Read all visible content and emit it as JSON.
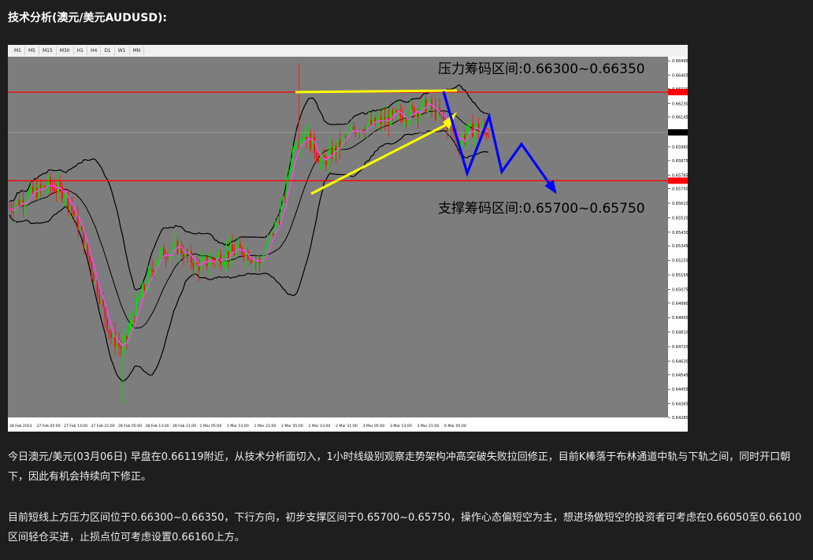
{
  "article": {
    "title": "技术分析(澳元/美元AUDUSD):",
    "paragraph1": "今日澳元/美元(03月06日) 早盘在0.66119附近，从技术分析面切入，1小时线级别观察走势架构冲高突破失败拉回修正，目前K棒落于布林通道中轨与下轨之间，同时开口朝下，因此有机会持续向下修正。",
    "paragraph2": "目前短线上方压力区间位于0.66300~0.66350，下行方向，初步支撑区间于0.65700~0.65750，操作心态偏短空为主，想进场做短空的投资者可考虑在0.66050至0.66100区间轻仓买进，止损点位可考虑设置0.66160上方。"
  },
  "toolbar": {
    "timeframes": [
      "M1",
      "M5",
      "M15",
      "M30",
      "H1",
      "H4",
      "D1",
      "W1",
      "MN"
    ]
  },
  "chart_data": {
    "type": "candlestick",
    "symbol": "AUDUSD",
    "timeframe": "H1",
    "annotations": {
      "resistance": "压力筹码区间:0.66300~0.66350",
      "support": "支撑筹码区间:0.65700~0.65750"
    },
    "resistance_level": 0.663,
    "support_level": 0.6575,
    "current_price": 0.6605,
    "ylim": [
      0.6428,
      0.6652
    ],
    "y_ticks": [
      "0.66495",
      "0.66405",
      "0.66320",
      "0.66230",
      "0.66145",
      "0.66050",
      "0.65960",
      "0.65875",
      "0.65785",
      "0.65700",
      "0.65610",
      "0.65520",
      "0.65430",
      "0.65345",
      "0.65255",
      "0.65165",
      "0.65075",
      "0.64990",
      "0.64900",
      "0.64810",
      "0.64720",
      "0.64630",
      "0.64545",
      "0.64455",
      "0.64365",
      "0.64280"
    ],
    "x_ticks": [
      "28 Feb 2023",
      "27 Feb 05:00",
      "27 Feb 13:00",
      "27 Feb 21:00",
      "28 Feb 05:00",
      "28 Feb 13:00",
      "28 Feb 21:00",
      "1 Mar 05:00",
      "1 Mar 13:00",
      "1 Mar 21:00",
      "2 Mar 05:00",
      "2 Mar 13:00",
      "2 Mar 21:00",
      "3 Mar 05:00",
      "3 Mar 13:00",
      "3 Mar 21:00",
      "6 Mar 05:00"
    ],
    "colors": {
      "background": "#7d7d7d",
      "bull_candle": "#00e000",
      "bear_candle": "#ff1010",
      "bands": "#000000",
      "middle_band": "#ff40ff",
      "level_line": "#ff0000",
      "yellow": "#ffff00",
      "blue": "#0000ff"
    }
  }
}
